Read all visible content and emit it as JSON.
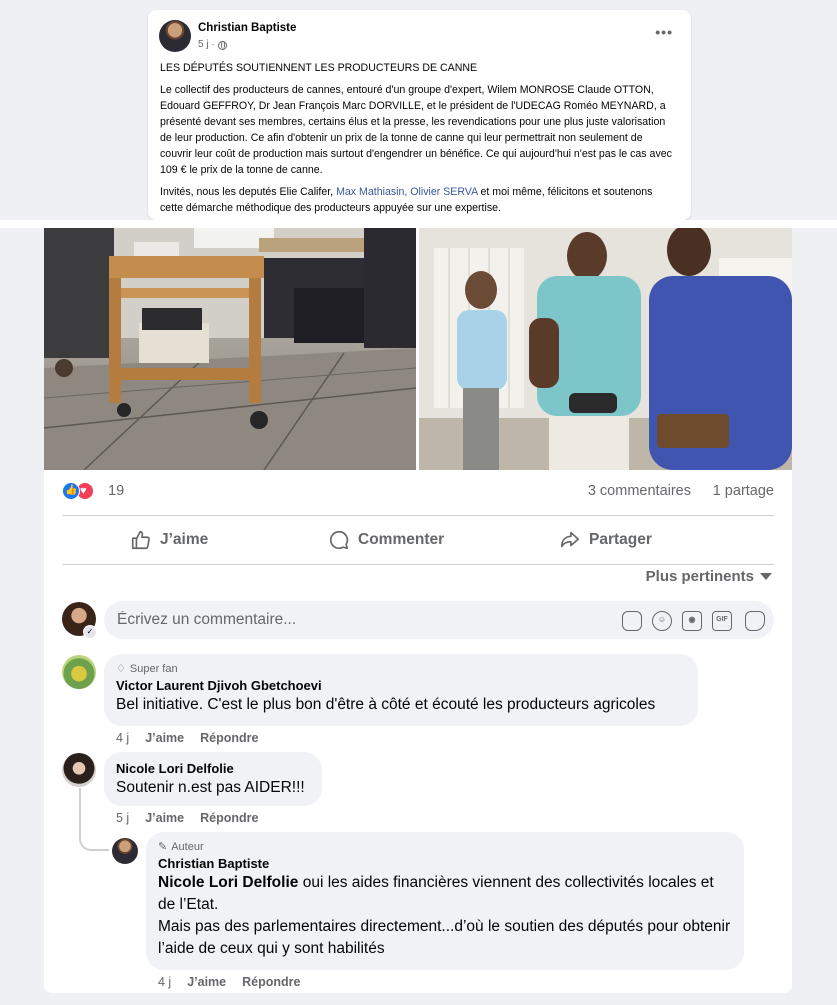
{
  "post": {
    "author": "Christian Baptiste",
    "time": "5 j ·",
    "more": "•••",
    "heading": "LES DÉPUTÉS SOUTIENNENT LES PRODUCTEURS DE CANNE",
    "paragraph1": "Le collectif des producteurs de cannes, entouré d'un groupe d'expert, Wilem MONROSE Claude OTTON, Edouard GEFFROY, Dr Jean François Marc DORVILLE, et le président de l'UDECAG Roméo MEYNARD, a présenté devant ses membres, certains élus et la presse, les revendications pour une plus juste valorisation de leur production. Ce afin d'obtenir un prix de la tonne de canne qui leur permettrait non seulement de couvrir leur coût de production mais surtout d'engendrer un bénéfice. Ce qui aujourd'hui n'est pas le cas avec 109 € le prix de la tonne de canne.",
    "paragraph2_start": "Invités, nous les deputés Elie Califer, ",
    "paragraph2_link": "Max Mathiasin, Olivier SERVA",
    "paragraph2_end": " et moi même, félicitons et soutenons cette démarche méthodique des producteurs appuyée sur une expertise."
  },
  "stats": {
    "reaction_count": "19",
    "comments": "3 commentaires",
    "shares": "1 partage"
  },
  "actions": {
    "like": "J’aime",
    "comment": "Commenter",
    "share": "Partager"
  },
  "sort": {
    "label": "Plus pertinents"
  },
  "composer": {
    "placeholder": "Écrivez un commentaire...",
    "badge": "✓",
    "gif": "GIF"
  },
  "comments": [
    {
      "badge": "Super fan",
      "author": "Victor Laurent Djivoh Gbetchoevi",
      "text": "Bel initiative. C'est le plus bon d'être à côté et écouté les producteurs agricoles",
      "time": "4 j",
      "like": "J’aime",
      "reply": "Répondre"
    },
    {
      "author": "Nicole Lori Delfolie",
      "text": "Soutenir n.est pas AIDER!!!",
      "time": "5 j",
      "like": "J’aime",
      "reply": "Répondre"
    },
    {
      "badge": "Auteur",
      "author": "Christian Baptiste",
      "mention": "Nicole Lori Delfolie",
      "text_line1": " oui les aides financières viennent des collectivités locales et de l’Etat.",
      "text_line2": "Mais pas des parlementaires directement...d’où le soutien des députés pour obtenir l’aide de ceux qui y sont habilités",
      "time": "4 j",
      "like": "J’aime",
      "reply": "Répondre"
    }
  ],
  "colors": {
    "link": "#385898",
    "like_blue": "#1877f2",
    "love_red": "#f33e58",
    "secondary_text": "#65676b"
  }
}
